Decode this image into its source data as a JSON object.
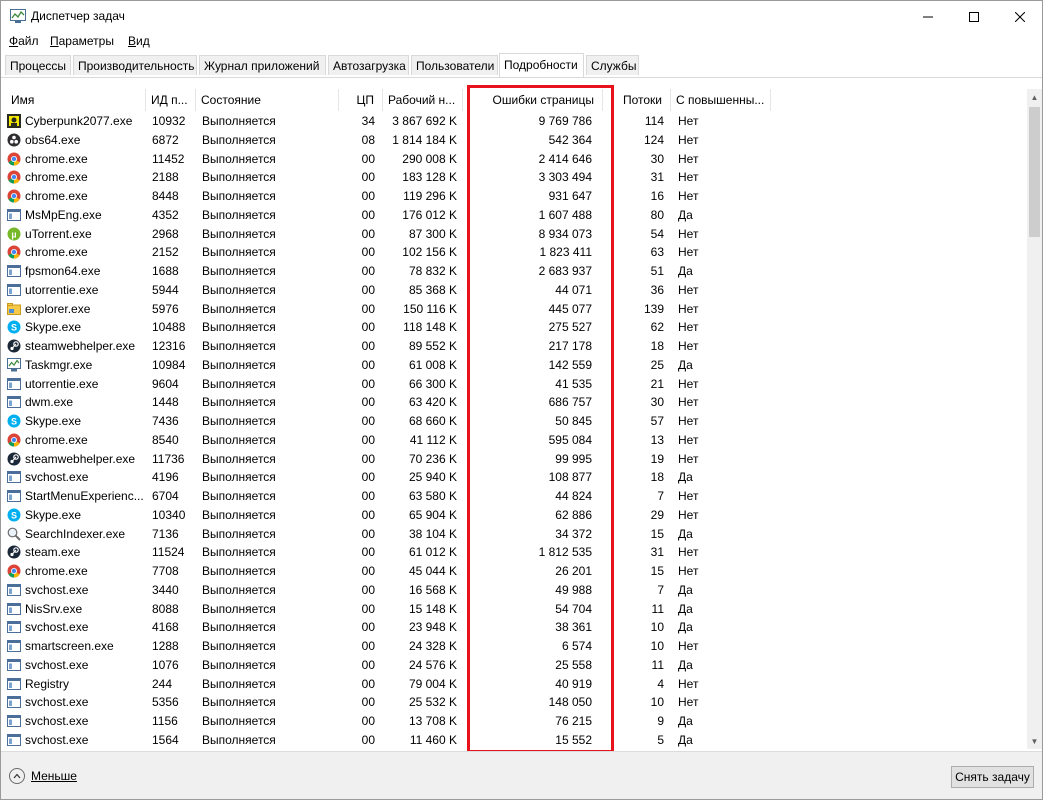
{
  "window": {
    "title": "Диспетчер задач",
    "minimize_icon": "minimize-icon",
    "maximize_icon": "maximize-icon",
    "close_icon": "close-icon"
  },
  "menu": [
    {
      "label": "Файл",
      "mnemonic": "Ф",
      "rest": "айл"
    },
    {
      "label": "Параметры",
      "mnemonic": "П",
      "rest": "араметры"
    },
    {
      "label": "Вид",
      "mnemonic": "В",
      "rest": "ид"
    }
  ],
  "tabs": [
    "Процессы",
    "Производительность",
    "Журнал приложений",
    "Автозагрузка",
    "Пользователи",
    "Подробности",
    "Службы"
  ],
  "active_tab": "Подробности",
  "columns": [
    "Имя",
    "ИД п...",
    "Состояние",
    "ЦП",
    "Рабочий н...",
    "Ошибки страницы",
    "Потоки",
    "С повышенны..."
  ],
  "rows": [
    [
      "Cyberpunk2077.exe",
      "10932",
      "Выполняется",
      "34",
      "3 867 692 K",
      "9 769 786",
      "114",
      "Нет",
      "cyberpunk"
    ],
    [
      "obs64.exe",
      "6872",
      "Выполняется",
      "08",
      "1 814 184 K",
      "542 364",
      "124",
      "Нет",
      "obs"
    ],
    [
      "chrome.exe",
      "11452",
      "Выполняется",
      "00",
      "290 008 K",
      "2 414 646",
      "30",
      "Нет",
      "chrome"
    ],
    [
      "chrome.exe",
      "2188",
      "Выполняется",
      "00",
      "183 128 K",
      "3 303 494",
      "31",
      "Нет",
      "chrome"
    ],
    [
      "chrome.exe",
      "8448",
      "Выполняется",
      "00",
      "119 296 K",
      "931 647",
      "16",
      "Нет",
      "chrome"
    ],
    [
      "MsMpEng.exe",
      "4352",
      "Выполняется",
      "00",
      "176 012 K",
      "1 607 488",
      "80",
      "Да",
      "window"
    ],
    [
      "uTorrent.exe",
      "2968",
      "Выполняется",
      "00",
      "87 300 K",
      "8 934 073",
      "54",
      "Нет",
      "utorrent"
    ],
    [
      "chrome.exe",
      "2152",
      "Выполняется",
      "00",
      "102 156 K",
      "1 823 411",
      "63",
      "Нет",
      "chrome"
    ],
    [
      "fpsmon64.exe",
      "1688",
      "Выполняется",
      "00",
      "78 832 K",
      "2 683 937",
      "51",
      "Да",
      "window"
    ],
    [
      "utorrentie.exe",
      "5944",
      "Выполняется",
      "00",
      "85 368 K",
      "44 071",
      "36",
      "Нет",
      "window"
    ],
    [
      "explorer.exe",
      "5976",
      "Выполняется",
      "00",
      "150 116 K",
      "445 077",
      "139",
      "Нет",
      "folder"
    ],
    [
      "Skype.exe",
      "10488",
      "Выполняется",
      "00",
      "118 148 K",
      "275 527",
      "62",
      "Нет",
      "skype"
    ],
    [
      "steamwebhelper.exe",
      "12316",
      "Выполняется",
      "00",
      "89 552 K",
      "217 178",
      "18",
      "Нет",
      "steam"
    ],
    [
      "Taskmgr.exe",
      "10984",
      "Выполняется",
      "00",
      "61 008 K",
      "142 559",
      "25",
      "Да",
      "taskmgr"
    ],
    [
      "utorrentie.exe",
      "9604",
      "Выполняется",
      "00",
      "66 300 K",
      "41 535",
      "21",
      "Нет",
      "window"
    ],
    [
      "dwm.exe",
      "1448",
      "Выполняется",
      "00",
      "63 420 K",
      "686 757",
      "30",
      "Нет",
      "window"
    ],
    [
      "Skype.exe",
      "7436",
      "Выполняется",
      "00",
      "68 660 K",
      "50 845",
      "57",
      "Нет",
      "skype"
    ],
    [
      "chrome.exe",
      "8540",
      "Выполняется",
      "00",
      "41 112 K",
      "595 084",
      "13",
      "Нет",
      "chrome"
    ],
    [
      "steamwebhelper.exe",
      "11736",
      "Выполняется",
      "00",
      "70 236 K",
      "99 995",
      "19",
      "Нет",
      "steam"
    ],
    [
      "svchost.exe",
      "4196",
      "Выполняется",
      "00",
      "25 940 K",
      "108 877",
      "18",
      "Да",
      "window"
    ],
    [
      "StartMenuExperienc...",
      "6704",
      "Выполняется",
      "00",
      "63 580 K",
      "44 824",
      "7",
      "Нет",
      "window"
    ],
    [
      "Skype.exe",
      "10340",
      "Выполняется",
      "00",
      "65 904 K",
      "62 886",
      "29",
      "Нет",
      "skype"
    ],
    [
      "SearchIndexer.exe",
      "7136",
      "Выполняется",
      "00",
      "38 104 K",
      "34 372",
      "15",
      "Да",
      "search"
    ],
    [
      "steam.exe",
      "11524",
      "Выполняется",
      "00",
      "61 012 K",
      "1 812 535",
      "31",
      "Нет",
      "steam"
    ],
    [
      "chrome.exe",
      "7708",
      "Выполняется",
      "00",
      "45 044 K",
      "26 201",
      "15",
      "Нет",
      "chrome"
    ],
    [
      "svchost.exe",
      "3440",
      "Выполняется",
      "00",
      "16 568 K",
      "49 988",
      "7",
      "Да",
      "window"
    ],
    [
      "NisSrv.exe",
      "8088",
      "Выполняется",
      "00",
      "15 148 K",
      "54 704",
      "11",
      "Да",
      "window"
    ],
    [
      "svchost.exe",
      "4168",
      "Выполняется",
      "00",
      "23 948 K",
      "38 361",
      "10",
      "Да",
      "window"
    ],
    [
      "smartscreen.exe",
      "1288",
      "Выполняется",
      "00",
      "24 328 K",
      "6 574",
      "10",
      "Нет",
      "window"
    ],
    [
      "svchost.exe",
      "1076",
      "Выполняется",
      "00",
      "24 576 K",
      "25 558",
      "11",
      "Да",
      "window"
    ],
    [
      "Registry",
      "244",
      "Выполняется",
      "00",
      "79 004 K",
      "40 919",
      "4",
      "Нет",
      "window"
    ],
    [
      "svchost.exe",
      "5356",
      "Выполняется",
      "00",
      "25 532 K",
      "148 050",
      "10",
      "Нет",
      "window"
    ],
    [
      "svchost.exe",
      "1156",
      "Выполняется",
      "00",
      "13 708 K",
      "76 215",
      "9",
      "Да",
      "window"
    ],
    [
      "svchost.exe",
      "1564",
      "Выполняется",
      "00",
      "11 460 K",
      "15 552",
      "5",
      "Да",
      "window"
    ]
  ],
  "footer": {
    "less_label": "Меньше",
    "end_task_label": "Снять задачу"
  },
  "colors": {
    "highlight": "#e8121c",
    "chrome_red": "#db4437",
    "chrome_yellow": "#f4b400",
    "chrome_green": "#0f9d58",
    "chrome_blue": "#4285f4",
    "skype": "#00aff0",
    "utorrent": "#77b82a",
    "steam": "#1b2838"
  }
}
